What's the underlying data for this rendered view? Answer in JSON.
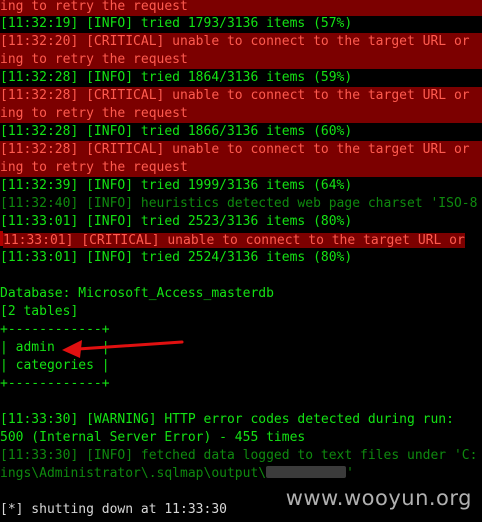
{
  "terminal": {
    "lines": [
      "ing to retry the request",
      "[11:32:19] [INFO] tried 1793/3136 items (57%)",
      "[11:32:20] [CRITICAL] unable to connect to the target URL or",
      "ing to retry the request",
      "[11:32:28] [INFO] tried 1864/3136 items (59%)",
      "[11:32:28] [CRITICAL] unable to connect to the target URL or",
      "ing to retry the request",
      "[11:32:28] [INFO] tried 1866/3136 items (60%)",
      "[11:32:28] [CRITICAL] unable to connect to the target URL or",
      "ing to retry the request",
      "[11:32:39] [INFO] tried 1999/3136 items (64%)",
      "[11:32:40] [INFO] heuristics detected web page charset 'ISO-8",
      "[11:33:01] [INFO] tried 2523/3136 items (80%)",
      "11:33:01] [CRITICAL] unable to connect to the target URL or",
      "[11:33:01] [INFO] tried 2524/3136 items (80%)",
      "",
      "Database: Microsoft_Access_masterdb",
      "[2 tables]",
      "+------------+",
      "| admin      |",
      "| categories |",
      "+------------+",
      "",
      "[11:33:30] [WARNING] HTTP error codes detected during run:",
      "500 (Internal Server Error) - 455 times",
      "[11:33:30] [INFO] fetched data logged to text files under 'C:",
      "ings\\Administrator\\.sqlmap\\output\\",
      "",
      "[*] shutting down at 11:33:30"
    ],
    "output_suffix": "'"
  },
  "watermark": "www.wooyun.org",
  "colors": {
    "background": "#000000",
    "info_text": "#14e214",
    "critical_bg": "#7c0000",
    "critical_text": "#ff5b4f",
    "arrow": "#e01010",
    "plain_text": "#d8d8d8"
  }
}
